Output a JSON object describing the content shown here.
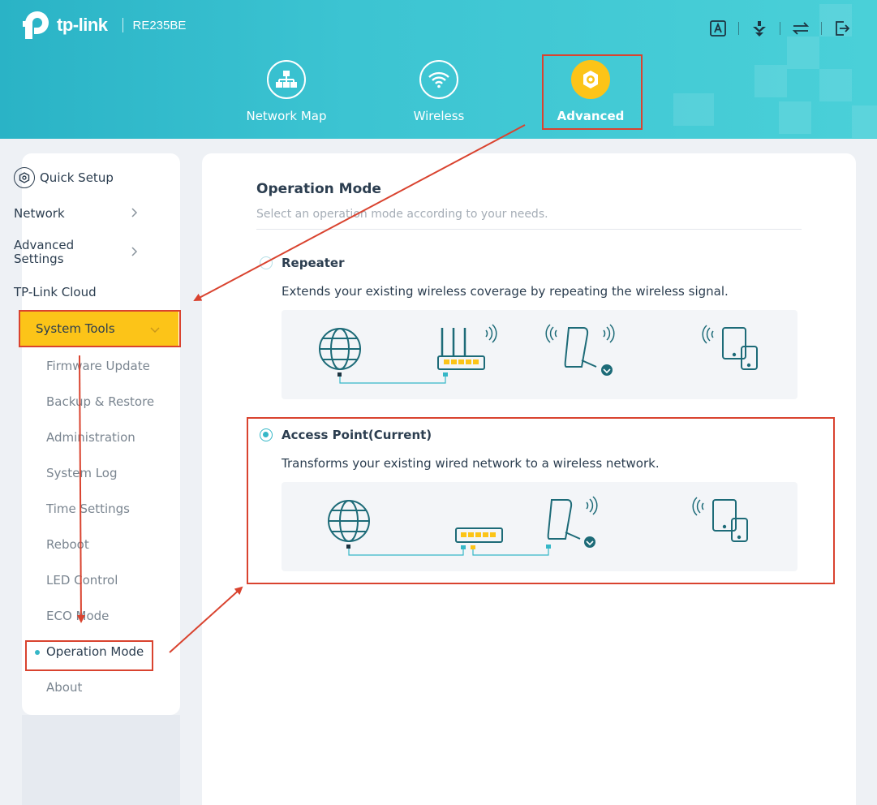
{
  "header": {
    "brand": "tp-link",
    "model": "RE235BE",
    "top_icons": [
      "language-icon",
      "download-icon",
      "switch-icon",
      "logout-icon"
    ],
    "tabs": [
      {
        "label": "Network Map",
        "icon": "network-map-icon",
        "active": false
      },
      {
        "label": "Wireless",
        "icon": "wifi-icon",
        "active": false
      },
      {
        "label": "Advanced",
        "icon": "gear-icon",
        "active": true
      }
    ]
  },
  "sidebar": {
    "quick_setup": "Quick Setup",
    "items": [
      "Network",
      "Advanced Settings",
      "TP-Link Cloud"
    ],
    "system_tools": "System Tools",
    "sub_items": [
      "Firmware Update",
      "Backup & Restore",
      "Administration",
      "System Log",
      "Time Settings",
      "Reboot",
      "LED Control",
      "ECO Mode",
      "Operation Mode",
      "About"
    ],
    "active_sub_item": "Operation Mode"
  },
  "main": {
    "title": "Operation Mode",
    "subtitle": "Select an operation mode according to your needs.",
    "options": [
      {
        "label": "Repeater",
        "description": "Extends your existing wireless coverage by repeating the wireless signal.",
        "selected": false
      },
      {
        "label": "Access Point(Current)",
        "description": "Transforms your existing wired network to a wireless network.",
        "selected": true
      }
    ]
  },
  "colors": {
    "header_teal": "#3cc4d2",
    "accent_yellow": "#fcc418",
    "accent_teal": "#36b7c7",
    "annotation_red": "#d9432f"
  }
}
